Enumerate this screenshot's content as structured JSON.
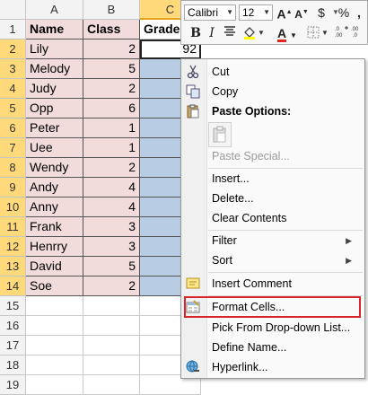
{
  "columns": [
    "A",
    "B",
    "C"
  ],
  "header_row": {
    "name": "Name",
    "class": "Class",
    "grade": "Grade"
  },
  "rows": [
    {
      "n": "1"
    },
    {
      "n": "2",
      "name": "Lily",
      "class": "2",
      "grade": "92"
    },
    {
      "n": "3",
      "name": "Melody",
      "class": "5",
      "grade": ""
    },
    {
      "n": "4",
      "name": "Judy",
      "class": "2",
      "grade": ""
    },
    {
      "n": "5",
      "name": "Opp",
      "class": "6",
      "grade": ""
    },
    {
      "n": "6",
      "name": "Peter",
      "class": "1",
      "grade": ""
    },
    {
      "n": "7",
      "name": "Uee",
      "class": "1",
      "grade": ""
    },
    {
      "n": "8",
      "name": "Wendy",
      "class": "2",
      "grade": ""
    },
    {
      "n": "9",
      "name": "Andy",
      "class": "4",
      "grade": ""
    },
    {
      "n": "10",
      "name": "Anny",
      "class": "4",
      "grade": ""
    },
    {
      "n": "11",
      "name": "Frank",
      "class": "3",
      "grade": ""
    },
    {
      "n": "12",
      "name": "Henrry",
      "class": "3",
      "grade": ""
    },
    {
      "n": "13",
      "name": "David",
      "class": "5",
      "grade": ""
    },
    {
      "n": "14",
      "name": "Soe",
      "class": "2",
      "grade": ""
    },
    {
      "n": "15"
    },
    {
      "n": "16"
    },
    {
      "n": "17"
    },
    {
      "n": "18"
    },
    {
      "n": "19"
    }
  ],
  "mini_toolbar": {
    "font": "Calibri",
    "size": "12",
    "grow_font": "A",
    "shrink_font": "A",
    "currency": "$",
    "percent": "%",
    "comma": ",",
    "bold": "B",
    "italic": "I",
    "font_color_letter": "A"
  },
  "menu": {
    "cut": "Cut",
    "copy": "Copy",
    "paste_options": "Paste Options:",
    "paste_special": "Paste Special...",
    "insert": "Insert...",
    "delete": "Delete...",
    "clear_contents": "Clear Contents",
    "filter": "Filter",
    "sort": "Sort",
    "insert_comment": "Insert Comment",
    "format_cells": "Format Cells...",
    "pick_dropdown": "Pick From Drop-down List...",
    "define_name": "Define Name...",
    "hyperlink": "Hyperlink..."
  },
  "icons": {
    "cut": "scissors-icon",
    "copy": "copy-icon",
    "paste": "clipboard-icon",
    "comment": "comment-icon",
    "format": "format-cells-icon",
    "hyperlink": "globe-link-icon"
  },
  "colors": {
    "name_class_fill": "#f2dcdb",
    "grade_fill": "#b8cce4",
    "selected_header": "#ffd97a",
    "highlight_box": "#d9262c"
  }
}
